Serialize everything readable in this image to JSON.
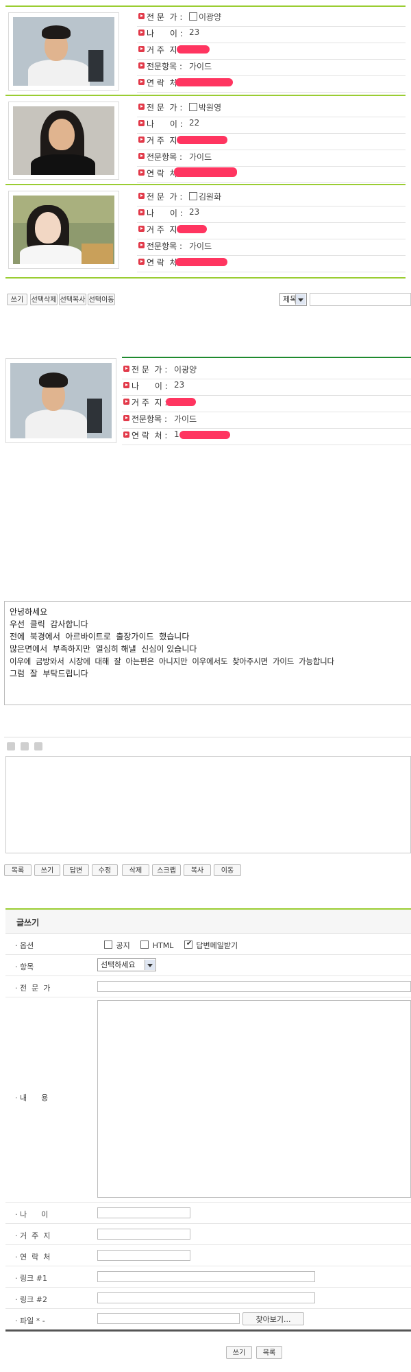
{
  "labels": {
    "expert": "전 문  가 :",
    "age": "나      이 :",
    "residence": "거 주  지 :",
    "specialty": "전문항목 :",
    "contact": "연 락  처 :"
  },
  "profiles": [
    {
      "expert": "이광양",
      "age": "23",
      "residence": "",
      "specialty": "가이드",
      "contact": ""
    },
    {
      "expert": "박원영",
      "age": "22",
      "residence": "",
      "specialty": "가이드",
      "contact": ""
    },
    {
      "expert": "김원화",
      "age": "23",
      "residence": "",
      "specialty": "가이드",
      "contact": ""
    }
  ],
  "list_toolbar": {
    "buttons": [
      "쓰기",
      "선택삭제",
      "선택복사",
      "선택이동"
    ],
    "search_field_select": "제목"
  },
  "detail": {
    "expert": "이광양",
    "age": "23",
    "residence": "",
    "specialty": "가이드",
    "contact": "1"
  },
  "message": [
    "안녕하세요",
    "우선  클릭  감사합니다",
    "전에  북경에서  아르바이트로  출장가이드  했습니다",
    "많은면에서  부족하지만  열심히 해낼  신심이 있습니다",
    "이우에  금방와서  시장에  대해  잘  아는편은  아니지만  이우에서도  찾아주시면  가이드  가능합니다",
    "그럼  잘  부탁드립니다"
  ],
  "detail_toolbar": {
    "buttons": [
      "목록",
      "쓰기",
      "답변",
      "수정",
      "삭제",
      "스크랩",
      "복사",
      "이동"
    ]
  },
  "write_form": {
    "title": "글쓰기",
    "labels": {
      "options": "· 옵션",
      "category": "· 항목",
      "expert": "· 전  문  가",
      "content": "· 내      용",
      "age": "· 나      이",
      "residence": "· 거  주  지",
      "contact": "· 연  락  처",
      "link1": "· 링크 #1",
      "link2": "· 링크 #2",
      "file": "· 파일 * -"
    },
    "option_notice": "공지",
    "option_html": "HTML",
    "option_reply_mail": "답변메일받기",
    "category_select": "선택하세요",
    "browse_button": "찾아보기...",
    "submit_button": "쓰기",
    "list_button": "목록"
  },
  "colors": {
    "accent_green": "#9acd32",
    "bullet_red": "#e23a4a",
    "redaction": "#ff3560"
  },
  "icons": [
    "bullet-arrow-icon",
    "checkbox-icon",
    "chevron-down-icon",
    "toolbar-up-icon",
    "toolbar-stop-icon",
    "toolbar-down-icon"
  ]
}
